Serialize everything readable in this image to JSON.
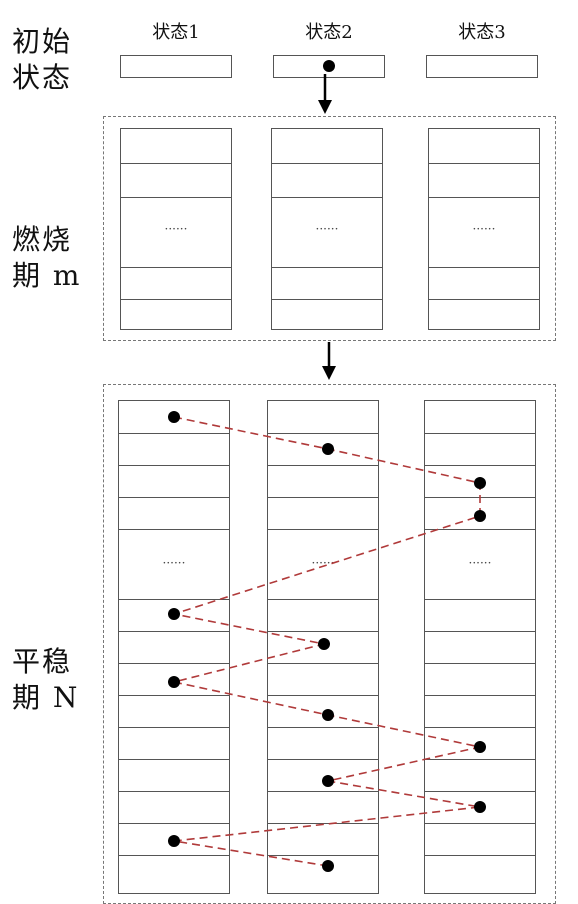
{
  "labels": {
    "initial": [
      "初始",
      "状态"
    ],
    "burn": [
      "燃烧",
      "期 m"
    ],
    "stable": [
      "平稳",
      "期 N"
    ]
  },
  "states": [
    "状态1",
    "状态2",
    "状态3"
  ],
  "ellipsis": "······",
  "colors": {
    "path": "#b03a3a",
    "line": "#555555",
    "dot": "#000000"
  }
}
